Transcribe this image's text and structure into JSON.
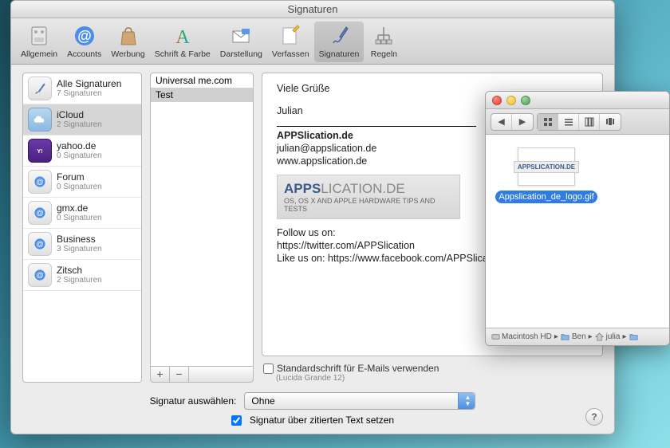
{
  "prefs": {
    "title": "Signaturen",
    "toolbar": [
      {
        "label": "Allgemein",
        "icon": "switch"
      },
      {
        "label": "Accounts",
        "icon": "at"
      },
      {
        "label": "Werbung",
        "icon": "bag"
      },
      {
        "label": "Schrift & Farbe",
        "icon": "font"
      },
      {
        "label": "Darstellung",
        "icon": "envelope"
      },
      {
        "label": "Verfassen",
        "icon": "pencil"
      },
      {
        "label": "Signaturen",
        "icon": "pen",
        "active": true
      },
      {
        "label": "Regeln",
        "icon": "rules"
      }
    ],
    "accounts": [
      {
        "name": "Alle Signaturen",
        "sub": "7 Signaturen",
        "icon": "pen"
      },
      {
        "name": "iCloud",
        "sub": "2 Signaturen",
        "icon": "cloud",
        "selected": true
      },
      {
        "name": "yahoo.de",
        "sub": "0 Signaturen",
        "icon": "yahoo"
      },
      {
        "name": "Forum",
        "sub": "0 Signaturen",
        "icon": "at"
      },
      {
        "name": "gmx.de",
        "sub": "0 Signaturen",
        "icon": "at"
      },
      {
        "name": "Business",
        "sub": "3 Signaturen",
        "icon": "at"
      },
      {
        "name": "Zitsch",
        "sub": "2 Signaturen",
        "icon": "at"
      }
    ],
    "signatures": [
      {
        "name": "Universal me.com"
      },
      {
        "name": "Test",
        "selected": true
      }
    ],
    "preview": {
      "greeting": "Viele Grüße",
      "name": "Julian",
      "domain": "APPSlication.de",
      "email": "julian@appslication.de",
      "url": "www.appslication.de",
      "logo_main": "APPS",
      "logo_sub": "LICATION.DE",
      "logo_tag": "OS, OS X AND APPLE HARDWARE TIPS AND TESTS",
      "follow": "Follow us on:",
      "twitter": "https://twitter.com/APPSlication",
      "like": "Like us on: https://www.facebook.com/APPSlica"
    },
    "options": {
      "standard_font": "Standardschrift für E-Mails verwenden",
      "font_detail": "(Lucida Grande 12)",
      "choose_label": "Signatur auswählen:",
      "choose_value": "Ohne",
      "place_above": "Signatur über zitierten Text setzen"
    }
  },
  "finder": {
    "file_name": "Appslication_de_logo.gif",
    "file_thumb": "APPSLICATION.DE",
    "path": [
      "Macintosh HD",
      "Ben",
      "julia"
    ]
  }
}
